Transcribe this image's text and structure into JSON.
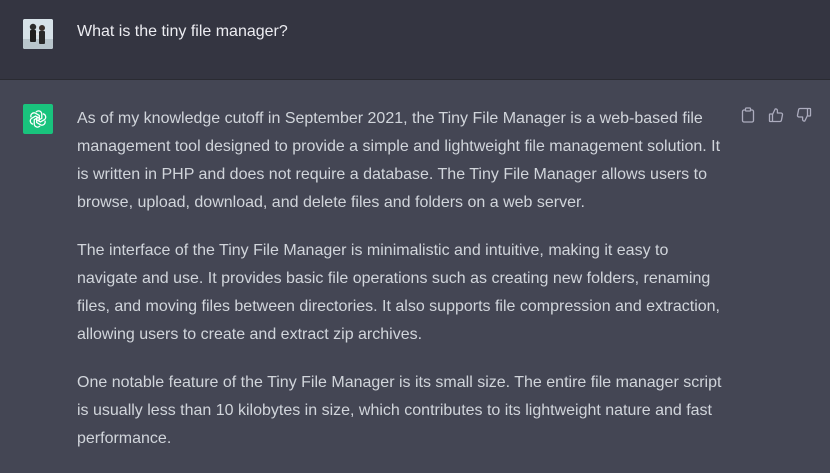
{
  "user_message": {
    "text": "What is the tiny file manager?",
    "avatar_icon": "user-photo-icon"
  },
  "assistant_message": {
    "avatar_icon": "openai-logo-icon",
    "avatar_color": "#19c37d",
    "paragraphs": [
      "As of my knowledge cutoff in September 2021, the Tiny File Manager is a web-based file management tool designed to provide a simple and lightweight file management solution. It is written in PHP and does not require a database. The Tiny File Manager allows users to browse, upload, download, and delete files and folders on a web server.",
      "The interface of the Tiny File Manager is minimalistic and intuitive, making it easy to navigate and use. It provides basic file operations such as creating new folders, renaming files, and moving files between directories. It also supports file compression and extraction, allowing users to create and extract zip archives.",
      "One notable feature of the Tiny File Manager is its small size. The entire file manager script is usually less than 10 kilobytes in size, which contributes to its lightweight nature and fast performance."
    ],
    "actions": [
      {
        "name": "copy-icon"
      },
      {
        "name": "thumbs-up-icon"
      },
      {
        "name": "thumbs-down-icon"
      }
    ]
  },
  "colors": {
    "user_bg": "#343541",
    "assistant_bg": "#444654",
    "text": "#d1d5db",
    "user_text": "#ececf1",
    "icon": "#acacbe"
  }
}
